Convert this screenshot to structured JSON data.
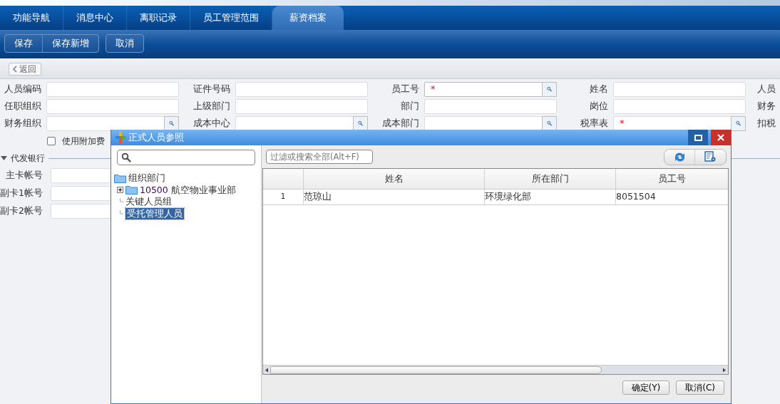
{
  "tabs": [
    {
      "label": "功能导航",
      "selected": false
    },
    {
      "label": "消息中心",
      "selected": false
    },
    {
      "label": "离职记录",
      "selected": false
    },
    {
      "label": "员工管理范围",
      "selected": false
    },
    {
      "label": "薪资档案",
      "selected": true
    }
  ],
  "toolbar": {
    "button_groups": [
      [
        "保存",
        "保存新增"
      ],
      [
        "取消"
      ]
    ]
  },
  "back_button": "返回",
  "form": {
    "rows": [
      [
        {
          "label": "人员编码",
          "lookup": false
        },
        {
          "label": "证件号码",
          "lookup": false
        },
        {
          "label": "员工号",
          "lookup": true,
          "required_mark": "*",
          "focused": true
        },
        {
          "label": "姓名",
          "lookup": false
        },
        {
          "label": "人员"
        }
      ],
      [
        {
          "label": "任职组织",
          "lookup": false
        },
        {
          "label": "上级部门",
          "lookup": false
        },
        {
          "label": "部门",
          "lookup": false
        },
        {
          "label": "岗位",
          "lookup": false
        },
        {
          "label": "财务"
        }
      ],
      [
        {
          "label": "财务组织",
          "lookup": true
        },
        {
          "label": "成本中心",
          "lookup": true
        },
        {
          "label": "成本部门",
          "lookup": true
        },
        {
          "label": "税率表",
          "lookup": true,
          "required_mark": "*"
        },
        {
          "label": "扣税"
        }
      ]
    ]
  },
  "checkbox": {
    "label": "使用附加费",
    "checked": false
  },
  "bank_section": {
    "title": "代发银行",
    "expanded": true,
    "fields": [
      "主卡帐号",
      "副卡1帐号",
      "副卡2帐号"
    ]
  },
  "dialog": {
    "title": "正式人员参照",
    "tree": {
      "label": "组织部门",
      "kind": "folder",
      "children": [
        {
          "code": "10500",
          "label": "航空物业事业部",
          "kind": "folder",
          "expanded": false,
          "selected": false
        },
        {
          "label": "关键人员组",
          "kind": "leaf",
          "selected": false
        },
        {
          "label": "受托管理人员",
          "kind": "leaf",
          "selected": true
        }
      ]
    },
    "filter_placeholder": "过滤或搜索全部(Alt+F)",
    "table": {
      "columns": [
        "姓名",
        "所在部门",
        "员工号"
      ],
      "rows": [
        {
          "index": "1",
          "cells": [
            "范琼山",
            "环境绿化部",
            "8051504"
          ],
          "selected": false
        }
      ]
    },
    "buttons": [
      "确定(Y)",
      "取消(C)"
    ]
  }
}
